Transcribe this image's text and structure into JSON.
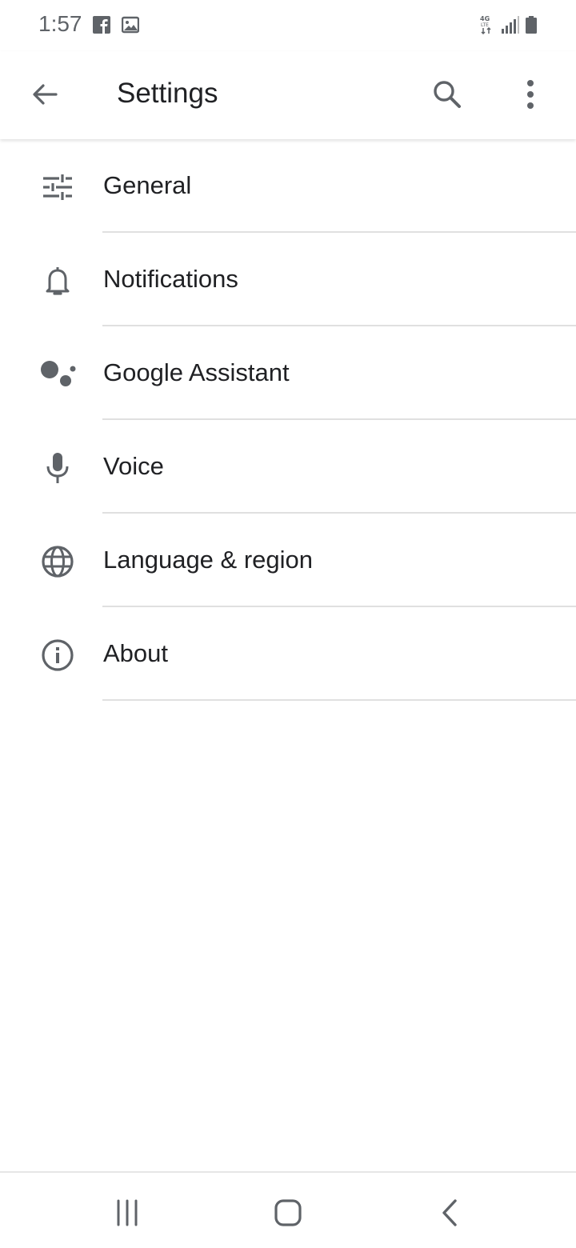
{
  "status_bar": {
    "time": "1:57",
    "left_icons": [
      "facebook-icon",
      "image-icon"
    ],
    "right_icons": [
      "4g-lte-icon",
      "signal-icon",
      "battery-icon"
    ],
    "network_label": "4G LTE"
  },
  "app_bar": {
    "title": "Settings",
    "back_icon": "arrow-left-icon",
    "search_icon": "search-icon",
    "more_icon": "more-vert-icon"
  },
  "settings": {
    "items": [
      {
        "label": "General",
        "icon": "tune-icon"
      },
      {
        "label": "Notifications",
        "icon": "bell-icon"
      },
      {
        "label": "Google Assistant",
        "icon": "assistant-icon"
      },
      {
        "label": "Voice",
        "icon": "mic-icon"
      },
      {
        "label": "Language & region",
        "icon": "globe-icon"
      },
      {
        "label": "About",
        "icon": "info-icon"
      }
    ]
  },
  "nav_bar": {
    "buttons": [
      "recent-apps-icon",
      "home-icon",
      "back-icon"
    ]
  },
  "colors": {
    "icon": "#5f6368",
    "text": "#202124",
    "divider": "#e0e0e0",
    "background": "#ffffff"
  }
}
